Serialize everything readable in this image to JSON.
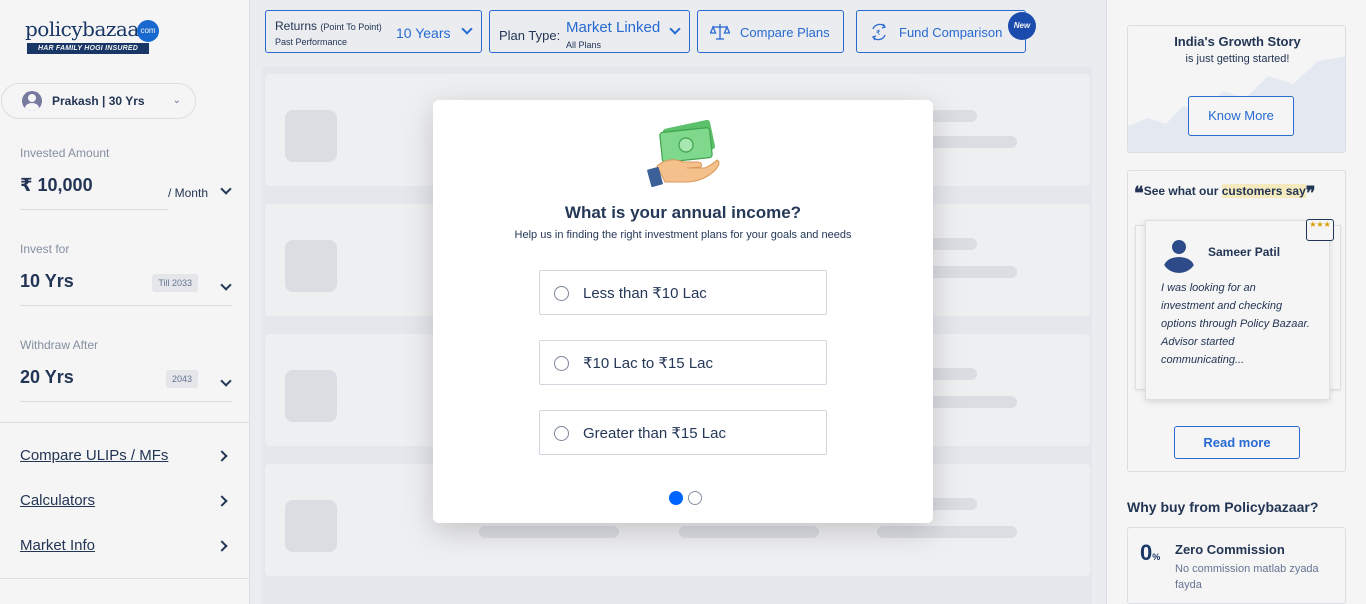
{
  "brand": {
    "logo_text": "policybazaar",
    "logo_badge": "com",
    "tagline": "HAR FAMILY HOGI INSURED"
  },
  "profile": {
    "label": "Prakash | 30 Yrs"
  },
  "invest_form": {
    "amount_label": "Invested Amount",
    "amount_value": "₹ 10,000",
    "amount_period": "/ Month",
    "invest_for_label": "Invest for",
    "invest_for_value": "10 Yrs",
    "invest_for_badge": "Till 2033",
    "withdraw_label": "Withdraw After",
    "withdraw_value": "20 Yrs",
    "withdraw_badge": "2043"
  },
  "side_links": [
    "Compare ULIPs / MFs",
    "Calculators",
    "Market Info"
  ],
  "topbar": {
    "returns_label": "Returns",
    "returns_small": "(Point To Point)",
    "returns_sub": "Past Performance",
    "returns_value": "10 Years",
    "plan_type_label": "Plan Type:",
    "plan_type_value": "Market Linked",
    "plan_type_sub": "All Plans",
    "compare_label": "Compare Plans",
    "fund_label": "Fund Comparison",
    "new_badge": "New"
  },
  "growth": {
    "title": "India's Growth Story",
    "subtitle": "is just getting started!",
    "button": "Know More"
  },
  "testimonials": {
    "open_quote": "❝",
    "heading_pre": "See what our ",
    "heading_highlight": "customers say",
    "close_quote": "❞",
    "name": "Sameer Patil",
    "stars": "★★★",
    "text": "I was looking for an investment and checking options through Policy Bazaar. Advisor started communicating...",
    "button": "Read more"
  },
  "why": {
    "title": "Why buy from Policybazaar?",
    "icon_text": "0",
    "icon_suffix": "%",
    "heading": "Zero Commission",
    "description": "No commission matlab zyada fayda"
  },
  "modal": {
    "title": "What is your annual income?",
    "subtitle": "Help us in finding the right investment plans for your goals and needs",
    "options": [
      "Less than ₹10 Lac",
      "₹10 Lac to ₹15 Lac",
      "Greater than ₹15 Lac"
    ],
    "step": 1,
    "total_steps": 2
  },
  "colors": {
    "primary": "#2a6fdb",
    "text": "#253858",
    "accent_dot": "#0065ff"
  },
  "icons": [
    "user-icon",
    "chevron-down-icon",
    "chevron-right-icon",
    "scale-icon",
    "fund-compare-icon",
    "money-hand-icon",
    "radio-icon",
    "quote-icon"
  ]
}
